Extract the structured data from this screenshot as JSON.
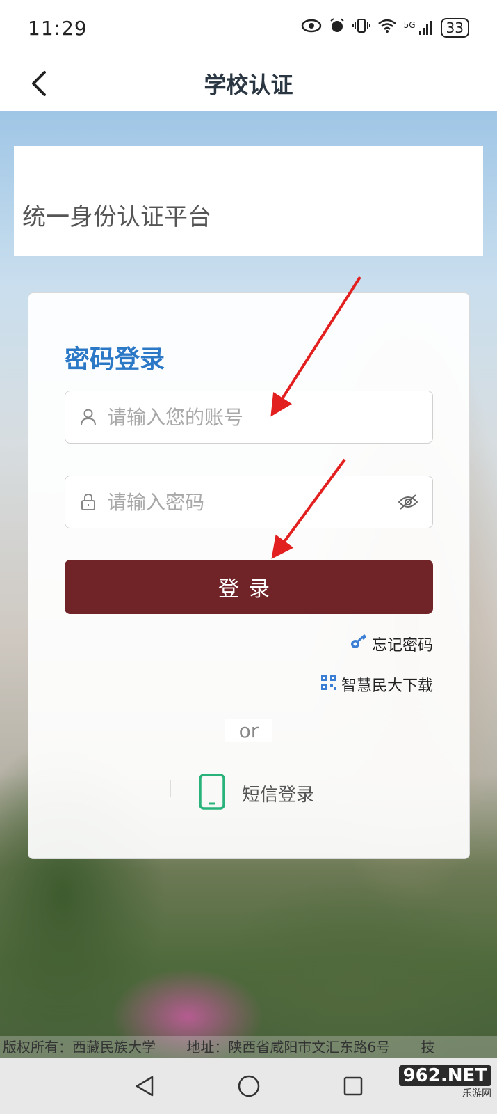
{
  "status_bar": {
    "time": "11:29",
    "battery": "33",
    "network": "5G"
  },
  "app_bar": {
    "title": "学校认证"
  },
  "banner": {
    "text": "统一身份认证平台"
  },
  "login_card": {
    "heading": "密码登录",
    "account_placeholder": "请输入您的账号",
    "password_placeholder": "请输入密码",
    "login_label": "登录",
    "forgot_label": "忘记密码",
    "download_label": "智慧民大下载",
    "or_text": "or",
    "sms_label": "短信登录"
  },
  "footer": {
    "copyright": "版权所有：西藏民族大学",
    "address": "地址：陕西省咸阳市文汇东路6号",
    "tail": "技"
  },
  "watermark": {
    "big": "962.NET",
    "small": "乐游网"
  },
  "colors": {
    "accent_blue": "#2b78c7",
    "login_button": "#712428",
    "sms_icon": "#29b37a"
  }
}
